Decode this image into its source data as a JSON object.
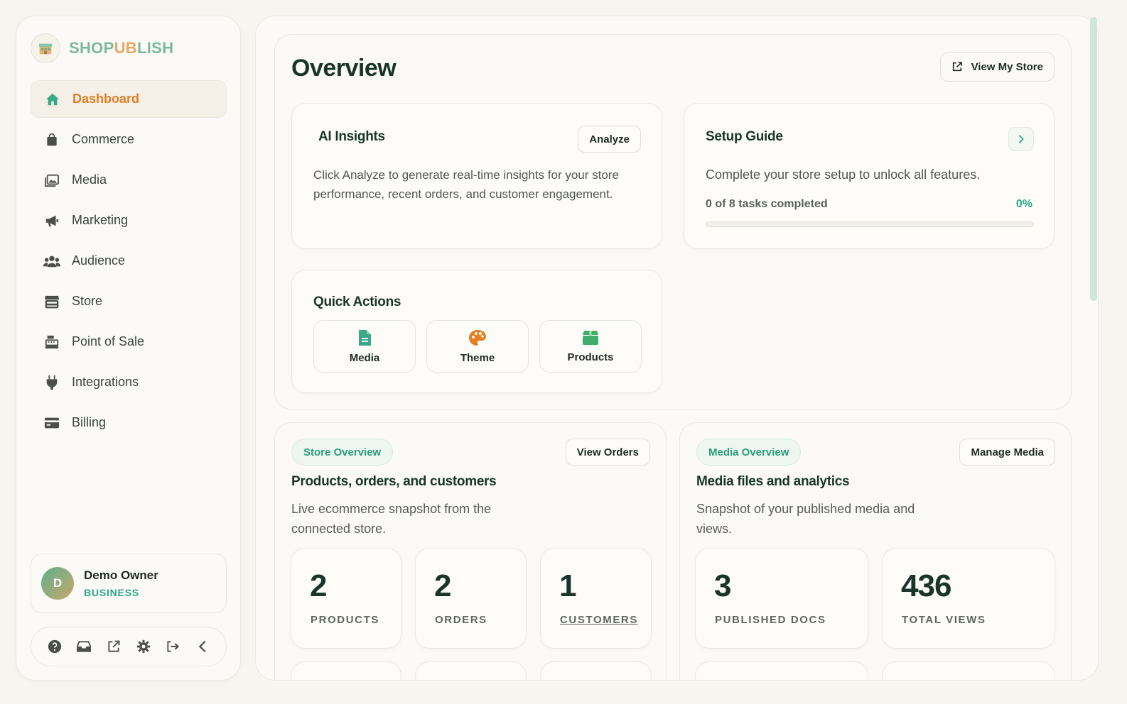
{
  "brand": {
    "part1": "SHOP",
    "part2": "UB",
    "part3": "LISH",
    "logo_icon": "store-building-icon"
  },
  "sidebar": {
    "items": [
      {
        "label": "Dashboard",
        "icon": "home-icon",
        "active": true
      },
      {
        "label": "Commerce",
        "icon": "shopping-bag-icon",
        "active": false
      },
      {
        "label": "Media",
        "icon": "images-icon",
        "active": false
      },
      {
        "label": "Marketing",
        "icon": "megaphone-icon",
        "active": false
      },
      {
        "label": "Audience",
        "icon": "users-icon",
        "active": false
      },
      {
        "label": "Store",
        "icon": "storefront-icon",
        "active": false
      },
      {
        "label": "Point of Sale",
        "icon": "cash-register-icon",
        "active": false
      },
      {
        "label": "Integrations",
        "icon": "plug-icon",
        "active": false
      },
      {
        "label": "Billing",
        "icon": "credit-card-icon",
        "active": false
      }
    ],
    "user": {
      "initial": "D",
      "name": "Demo Owner",
      "plan": "BUSINESS"
    },
    "footer_icons": [
      "help-icon",
      "inbox-icon",
      "external-link-icon",
      "settings-icon",
      "logout-icon",
      "collapse-chevron-icon"
    ]
  },
  "header": {
    "title": "Overview",
    "view_store_label": "View My Store"
  },
  "ai_insights": {
    "title": "AI Insights",
    "button": "Analyze",
    "text": "Click Analyze to generate real-time insights for your store performance, recent orders, and customer engagement."
  },
  "setup_guide": {
    "title": "Setup Guide",
    "text": "Complete your store setup to unlock all features.",
    "progress_label": "0 of 8 tasks completed",
    "progress_pct_label": "0%",
    "progress_fraction": 0
  },
  "quick_actions": {
    "title": "Quick Actions",
    "items": [
      {
        "label": "Media",
        "icon": "document-icon"
      },
      {
        "label": "Theme",
        "icon": "palette-icon"
      },
      {
        "label": "Products",
        "icon": "box-icon"
      }
    ]
  },
  "store_overview": {
    "tag": "Store Overview",
    "button": "View Orders",
    "title": "Products, orders, and customers",
    "subtitle": "Live ecommerce snapshot from the connected store.",
    "stats": [
      {
        "value": "2",
        "label": "PRODUCTS"
      },
      {
        "value": "2",
        "label": "ORDERS"
      },
      {
        "value": "1",
        "label": "CUSTOMERS"
      }
    ]
  },
  "media_overview": {
    "tag": "Media Overview",
    "button": "Manage Media",
    "title": "Media files and analytics",
    "subtitle": "Snapshot of your published media and views.",
    "stats": [
      {
        "value": "3",
        "label": "PUBLISHED DOCS"
      },
      {
        "value": "436",
        "label": "TOTAL VIEWS"
      }
    ]
  },
  "colors": {
    "accent": "#2aa985",
    "active_nav": "#e67e22",
    "heading": "#19352b",
    "background": "#f7f5f0"
  }
}
